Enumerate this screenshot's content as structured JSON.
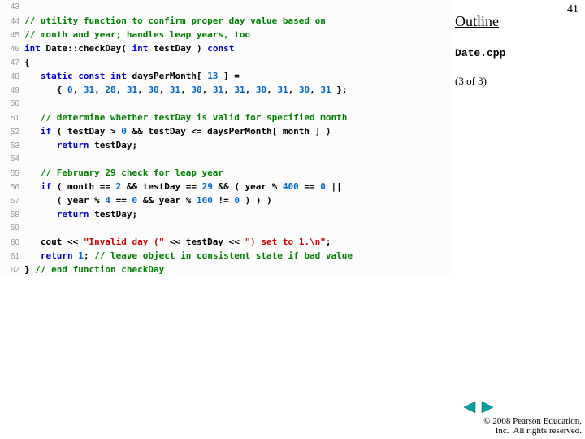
{
  "page_number": "41",
  "outline_label": "Outline",
  "filename": "Date.cpp",
  "part": "(3 of 3)",
  "copyright": "© 2008 Pearson Education,\nInc.  All rights reserved.",
  "code": [
    {
      "n": "43",
      "tokens": []
    },
    {
      "n": "44",
      "tokens": [
        {
          "c": "c-comment",
          "t": "// utility function to confirm proper day value based on"
        }
      ]
    },
    {
      "n": "45",
      "tokens": [
        {
          "c": "c-comment",
          "t": "// month and year; handles leap years, too"
        }
      ]
    },
    {
      "n": "46",
      "tokens": [
        {
          "c": "c-kw",
          "t": "int"
        },
        {
          "c": "c-txt",
          "t": " Date::checkDay( "
        },
        {
          "c": "c-kw",
          "t": "int"
        },
        {
          "c": "c-txt",
          "t": " testDay ) "
        },
        {
          "c": "c-kw",
          "t": "const"
        }
      ]
    },
    {
      "n": "47",
      "tokens": [
        {
          "c": "c-txt",
          "t": "{"
        }
      ]
    },
    {
      "n": "48",
      "tokens": [
        {
          "c": "c-txt",
          "t": "   "
        },
        {
          "c": "c-kw",
          "t": "static const int"
        },
        {
          "c": "c-txt",
          "t": " daysPerMonth[ "
        },
        {
          "c": "c-num",
          "t": "13"
        },
        {
          "c": "c-txt",
          "t": " ] ="
        }
      ]
    },
    {
      "n": "49",
      "tokens": [
        {
          "c": "c-txt",
          "t": "      { "
        },
        {
          "c": "c-num",
          "t": "0"
        },
        {
          "c": "c-txt",
          "t": ", "
        },
        {
          "c": "c-num",
          "t": "31"
        },
        {
          "c": "c-txt",
          "t": ", "
        },
        {
          "c": "c-num",
          "t": "28"
        },
        {
          "c": "c-txt",
          "t": ", "
        },
        {
          "c": "c-num",
          "t": "31"
        },
        {
          "c": "c-txt",
          "t": ", "
        },
        {
          "c": "c-num",
          "t": "30"
        },
        {
          "c": "c-txt",
          "t": ", "
        },
        {
          "c": "c-num",
          "t": "31"
        },
        {
          "c": "c-txt",
          "t": ", "
        },
        {
          "c": "c-num",
          "t": "30"
        },
        {
          "c": "c-txt",
          "t": ", "
        },
        {
          "c": "c-num",
          "t": "31"
        },
        {
          "c": "c-txt",
          "t": ", "
        },
        {
          "c": "c-num",
          "t": "31"
        },
        {
          "c": "c-txt",
          "t": ", "
        },
        {
          "c": "c-num",
          "t": "30"
        },
        {
          "c": "c-txt",
          "t": ", "
        },
        {
          "c": "c-num",
          "t": "31"
        },
        {
          "c": "c-txt",
          "t": ", "
        },
        {
          "c": "c-num",
          "t": "30"
        },
        {
          "c": "c-txt",
          "t": ", "
        },
        {
          "c": "c-num",
          "t": "31"
        },
        {
          "c": "c-txt",
          "t": " };"
        }
      ]
    },
    {
      "n": "50",
      "tokens": []
    },
    {
      "n": "51",
      "tokens": [
        {
          "c": "c-txt",
          "t": "   "
        },
        {
          "c": "c-comment",
          "t": "// determine whether testDay is valid for specified month"
        }
      ]
    },
    {
      "n": "52",
      "tokens": [
        {
          "c": "c-txt",
          "t": "   "
        },
        {
          "c": "c-kw",
          "t": "if"
        },
        {
          "c": "c-txt",
          "t": " ( testDay > "
        },
        {
          "c": "c-num",
          "t": "0"
        },
        {
          "c": "c-txt",
          "t": " && testDay <= daysPerMonth[ month ] )"
        }
      ]
    },
    {
      "n": "53",
      "tokens": [
        {
          "c": "c-txt",
          "t": "      "
        },
        {
          "c": "c-kw",
          "t": "return"
        },
        {
          "c": "c-txt",
          "t": " testDay;"
        }
      ]
    },
    {
      "n": "54",
      "tokens": []
    },
    {
      "n": "55",
      "tokens": [
        {
          "c": "c-txt",
          "t": "   "
        },
        {
          "c": "c-comment",
          "t": "// February 29 check for leap year"
        }
      ]
    },
    {
      "n": "56",
      "tokens": [
        {
          "c": "c-txt",
          "t": "   "
        },
        {
          "c": "c-kw",
          "t": "if"
        },
        {
          "c": "c-txt",
          "t": " ( month == "
        },
        {
          "c": "c-num",
          "t": "2"
        },
        {
          "c": "c-txt",
          "t": " && testDay == "
        },
        {
          "c": "c-num",
          "t": "29"
        },
        {
          "c": "c-txt",
          "t": " && ( year % "
        },
        {
          "c": "c-num",
          "t": "400"
        },
        {
          "c": "c-txt",
          "t": " == "
        },
        {
          "c": "c-num",
          "t": "0"
        },
        {
          "c": "c-txt",
          "t": " ||"
        }
      ]
    },
    {
      "n": "57",
      "tokens": [
        {
          "c": "c-txt",
          "t": "      ( year % "
        },
        {
          "c": "c-num",
          "t": "4"
        },
        {
          "c": "c-txt",
          "t": " == "
        },
        {
          "c": "c-num",
          "t": "0"
        },
        {
          "c": "c-txt",
          "t": " && year % "
        },
        {
          "c": "c-num",
          "t": "100"
        },
        {
          "c": "c-txt",
          "t": " != "
        },
        {
          "c": "c-num",
          "t": "0"
        },
        {
          "c": "c-txt",
          "t": " ) ) )"
        }
      ]
    },
    {
      "n": "58",
      "tokens": [
        {
          "c": "c-txt",
          "t": "      "
        },
        {
          "c": "c-kw",
          "t": "return"
        },
        {
          "c": "c-txt",
          "t": " testDay;"
        }
      ]
    },
    {
      "n": "59",
      "tokens": []
    },
    {
      "n": "60",
      "tokens": [
        {
          "c": "c-txt",
          "t": "   cout << "
        },
        {
          "c": "c-str",
          "t": "\"Invalid day (\""
        },
        {
          "c": "c-txt",
          "t": " << testDay << "
        },
        {
          "c": "c-str",
          "t": "\") set to 1.\\n\""
        },
        {
          "c": "c-txt",
          "t": ";"
        }
      ]
    },
    {
      "n": "61",
      "tokens": [
        {
          "c": "c-txt",
          "t": "   "
        },
        {
          "c": "c-kw",
          "t": "return"
        },
        {
          "c": "c-txt",
          "t": " "
        },
        {
          "c": "c-num",
          "t": "1"
        },
        {
          "c": "c-txt",
          "t": "; "
        },
        {
          "c": "c-comment",
          "t": "// leave object in consistent state if bad value"
        }
      ]
    },
    {
      "n": "62",
      "tokens": [
        {
          "c": "c-txt",
          "t": "} "
        },
        {
          "c": "c-comment",
          "t": "// end function checkDay"
        }
      ]
    }
  ]
}
